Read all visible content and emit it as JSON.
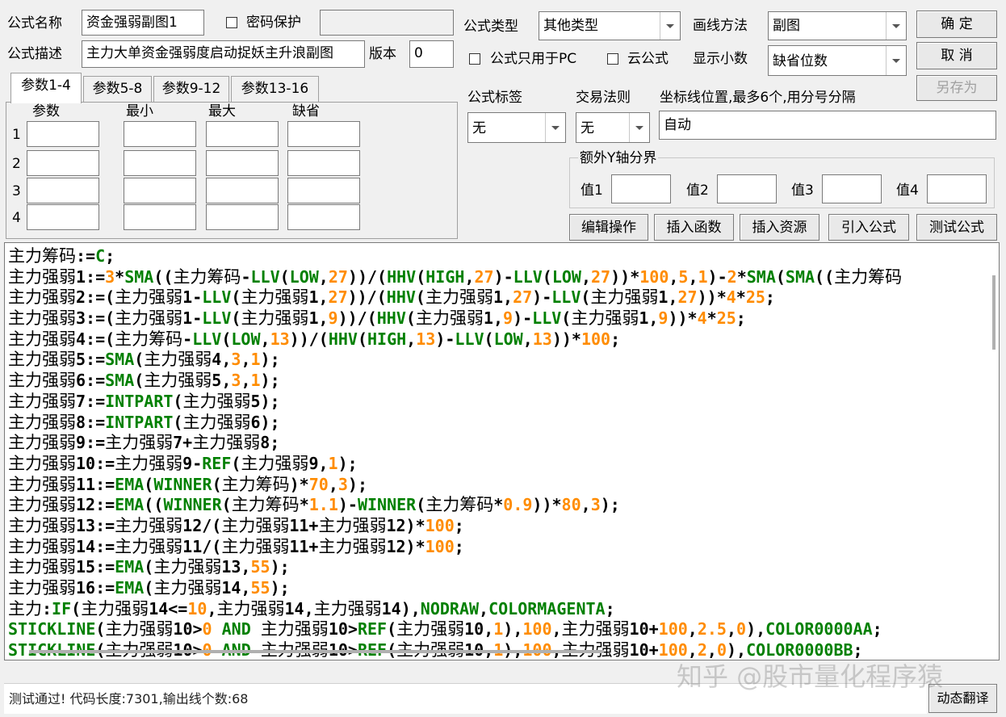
{
  "form": {
    "name_label": "公式名称",
    "name_value": "资金强弱副图1",
    "password_label": "密码保护",
    "desc_label": "公式描述",
    "desc_value": "主力大单资金强弱度启动捉妖主升浪副图",
    "version_label": "版本",
    "version_value": "0",
    "type_label": "公式类型",
    "type_value": "其他类型",
    "draw_label": "画线方法",
    "draw_value": "副图",
    "pc_only_label": "公式只用于PC",
    "cloud_label": "云公式",
    "decimals_label": "显示小数",
    "decimals_value": "缺省位数",
    "tag_label": "公式标签",
    "tag_value": "无",
    "rule_label": "交易法则",
    "rule_value": "无",
    "axis_label": "坐标线位置,最多6个,用分号分隔",
    "axis_value": "自动",
    "y_group_label": "额外Y轴分界",
    "y1_label": "值1",
    "y2_label": "值2",
    "y3_label": "值3",
    "y4_label": "值4"
  },
  "buttons": {
    "ok": "确  定",
    "cancel": "取  消",
    "save_as": "另存为",
    "edit": "编辑操作",
    "insert_func": "插入函数",
    "insert_res": "插入资源",
    "import": "引入公式",
    "test": "测试公式",
    "translate": "动态翻译"
  },
  "tabs": [
    "参数1-4",
    "参数5-8",
    "参数9-12",
    "参数13-16"
  ],
  "params": {
    "headers": [
      "参数",
      "最小",
      "最大",
      "缺省"
    ],
    "rows": [
      "1",
      "2",
      "3",
      "4"
    ]
  },
  "code_lines": [
    [
      [
        "cn",
        "主力筹码"
      ],
      [
        "op",
        ":="
      ],
      [
        "kw",
        "C"
      ],
      [
        "op",
        ";"
      ]
    ],
    [
      [
        "cn",
        "主力强弱"
      ],
      [
        "op",
        "1:="
      ],
      [
        "num",
        "3"
      ],
      [
        "op",
        "*"
      ],
      [
        "kw",
        "SMA"
      ],
      [
        "op",
        "(("
      ],
      [
        "cn",
        "主力筹码"
      ],
      [
        "op",
        "-"
      ],
      [
        "kw",
        "LLV"
      ],
      [
        "op",
        "("
      ],
      [
        "kw",
        "LOW"
      ],
      [
        "op",
        ","
      ],
      [
        "num",
        "27"
      ],
      [
        "op",
        "))/("
      ],
      [
        "kw",
        "HHV"
      ],
      [
        "op",
        "("
      ],
      [
        "kw",
        "HIGH"
      ],
      [
        "op",
        ","
      ],
      [
        "num",
        "27"
      ],
      [
        "op",
        ")-"
      ],
      [
        "kw",
        "LLV"
      ],
      [
        "op",
        "("
      ],
      [
        "kw",
        "LOW"
      ],
      [
        "op",
        ","
      ],
      [
        "num",
        "27"
      ],
      [
        "op",
        "))*"
      ],
      [
        "num",
        "100"
      ],
      [
        "op",
        ","
      ],
      [
        "num",
        "5"
      ],
      [
        "op",
        ","
      ],
      [
        "num",
        "1"
      ],
      [
        "op",
        ")-"
      ],
      [
        "num",
        "2"
      ],
      [
        "op",
        "*"
      ],
      [
        "kw",
        "SMA"
      ],
      [
        "op",
        "("
      ],
      [
        "kw",
        "SMA"
      ],
      [
        "op",
        "(("
      ],
      [
        "cn",
        "主力筹码"
      ]
    ],
    [
      [
        "cn",
        "主力强弱"
      ],
      [
        "op",
        "2:=("
      ],
      [
        "cn",
        "主力强弱"
      ],
      [
        "op",
        "1-"
      ],
      [
        "kw",
        "LLV"
      ],
      [
        "op",
        "("
      ],
      [
        "cn",
        "主力强弱"
      ],
      [
        "op",
        "1,"
      ],
      [
        "num",
        "27"
      ],
      [
        "op",
        "))/("
      ],
      [
        "kw",
        "HHV"
      ],
      [
        "op",
        "("
      ],
      [
        "cn",
        "主力强弱"
      ],
      [
        "op",
        "1,"
      ],
      [
        "num",
        "27"
      ],
      [
        "op",
        ")-"
      ],
      [
        "kw",
        "LLV"
      ],
      [
        "op",
        "("
      ],
      [
        "cn",
        "主力强弱"
      ],
      [
        "op",
        "1,"
      ],
      [
        "num",
        "27"
      ],
      [
        "op",
        "))*"
      ],
      [
        "num",
        "4"
      ],
      [
        "op",
        "*"
      ],
      [
        "num",
        "25"
      ],
      [
        "op",
        ";"
      ]
    ],
    [
      [
        "cn",
        "主力强弱"
      ],
      [
        "op",
        "3:=("
      ],
      [
        "cn",
        "主力强弱"
      ],
      [
        "op",
        "1-"
      ],
      [
        "kw",
        "LLV"
      ],
      [
        "op",
        "("
      ],
      [
        "cn",
        "主力强弱"
      ],
      [
        "op",
        "1,"
      ],
      [
        "num",
        "9"
      ],
      [
        "op",
        "))/("
      ],
      [
        "kw",
        "HHV"
      ],
      [
        "op",
        "("
      ],
      [
        "cn",
        "主力强弱"
      ],
      [
        "op",
        "1,"
      ],
      [
        "num",
        "9"
      ],
      [
        "op",
        ")-"
      ],
      [
        "kw",
        "LLV"
      ],
      [
        "op",
        "("
      ],
      [
        "cn",
        "主力强弱"
      ],
      [
        "op",
        "1,"
      ],
      [
        "num",
        "9"
      ],
      [
        "op",
        "))*"
      ],
      [
        "num",
        "4"
      ],
      [
        "op",
        "*"
      ],
      [
        "num",
        "25"
      ],
      [
        "op",
        ";"
      ]
    ],
    [
      [
        "cn",
        "主力强弱"
      ],
      [
        "op",
        "4:=("
      ],
      [
        "cn",
        "主力筹码"
      ],
      [
        "op",
        "-"
      ],
      [
        "kw",
        "LLV"
      ],
      [
        "op",
        "("
      ],
      [
        "kw",
        "LOW"
      ],
      [
        "op",
        ","
      ],
      [
        "num",
        "13"
      ],
      [
        "op",
        "))/("
      ],
      [
        "kw",
        "HHV"
      ],
      [
        "op",
        "("
      ],
      [
        "kw",
        "HIGH"
      ],
      [
        "op",
        ","
      ],
      [
        "num",
        "13"
      ],
      [
        "op",
        ")-"
      ],
      [
        "kw",
        "LLV"
      ],
      [
        "op",
        "("
      ],
      [
        "kw",
        "LOW"
      ],
      [
        "op",
        ","
      ],
      [
        "num",
        "13"
      ],
      [
        "op",
        "))*"
      ],
      [
        "num",
        "100"
      ],
      [
        "op",
        ";"
      ]
    ],
    [
      [
        "cn",
        "主力强弱"
      ],
      [
        "op",
        "5:="
      ],
      [
        "kw",
        "SMA"
      ],
      [
        "op",
        "("
      ],
      [
        "cn",
        "主力强弱"
      ],
      [
        "op",
        "4,"
      ],
      [
        "num",
        "3"
      ],
      [
        "op",
        ","
      ],
      [
        "num",
        "1"
      ],
      [
        "op",
        ");"
      ]
    ],
    [
      [
        "cn",
        "主力强弱"
      ],
      [
        "op",
        "6:="
      ],
      [
        "kw",
        "SMA"
      ],
      [
        "op",
        "("
      ],
      [
        "cn",
        "主力强弱"
      ],
      [
        "op",
        "5,"
      ],
      [
        "num",
        "3"
      ],
      [
        "op",
        ","
      ],
      [
        "num",
        "1"
      ],
      [
        "op",
        ");"
      ]
    ],
    [
      [
        "cn",
        "主力强弱"
      ],
      [
        "op",
        "7:="
      ],
      [
        "kw",
        "INTPART"
      ],
      [
        "op",
        "("
      ],
      [
        "cn",
        "主力强弱"
      ],
      [
        "op",
        "5);"
      ]
    ],
    [
      [
        "cn",
        "主力强弱"
      ],
      [
        "op",
        "8:="
      ],
      [
        "kw",
        "INTPART"
      ],
      [
        "op",
        "("
      ],
      [
        "cn",
        "主力强弱"
      ],
      [
        "op",
        "6);"
      ]
    ],
    [
      [
        "cn",
        "主力强弱"
      ],
      [
        "op",
        "9:="
      ],
      [
        "cn",
        "主力强弱"
      ],
      [
        "op",
        "7+"
      ],
      [
        "cn",
        "主力强弱"
      ],
      [
        "op",
        "8;"
      ]
    ],
    [
      [
        "cn",
        "主力强弱"
      ],
      [
        "op",
        "10:="
      ],
      [
        "cn",
        "主力强弱"
      ],
      [
        "op",
        "9-"
      ],
      [
        "kw",
        "REF"
      ],
      [
        "op",
        "("
      ],
      [
        "cn",
        "主力强弱"
      ],
      [
        "op",
        "9,"
      ],
      [
        "num",
        "1"
      ],
      [
        "op",
        ");"
      ]
    ],
    [
      [
        "cn",
        "主力强弱"
      ],
      [
        "op",
        "11:="
      ],
      [
        "kw",
        "EMA"
      ],
      [
        "op",
        "("
      ],
      [
        "kw",
        "WINNER"
      ],
      [
        "op",
        "("
      ],
      [
        "cn",
        "主力筹码"
      ],
      [
        "op",
        ")*"
      ],
      [
        "num",
        "70"
      ],
      [
        "op",
        ","
      ],
      [
        "num",
        "3"
      ],
      [
        "op",
        ");"
      ]
    ],
    [
      [
        "cn",
        "主力强弱"
      ],
      [
        "op",
        "12:="
      ],
      [
        "kw",
        "EMA"
      ],
      [
        "op",
        "(("
      ],
      [
        "kw",
        "WINNER"
      ],
      [
        "op",
        "("
      ],
      [
        "cn",
        "主力筹码"
      ],
      [
        "op",
        "*"
      ],
      [
        "num",
        "1.1"
      ],
      [
        "op",
        ")-"
      ],
      [
        "kw",
        "WINNER"
      ],
      [
        "op",
        "("
      ],
      [
        "cn",
        "主力筹码"
      ],
      [
        "op",
        "*"
      ],
      [
        "num",
        "0.9"
      ],
      [
        "op",
        "))*"
      ],
      [
        "num",
        "80"
      ],
      [
        "op",
        ","
      ],
      [
        "num",
        "3"
      ],
      [
        "op",
        ");"
      ]
    ],
    [
      [
        "cn",
        "主力强弱"
      ],
      [
        "op",
        "13:="
      ],
      [
        "cn",
        "主力强弱"
      ],
      [
        "op",
        "12/("
      ],
      [
        "cn",
        "主力强弱"
      ],
      [
        "op",
        "11+"
      ],
      [
        "cn",
        "主力强弱"
      ],
      [
        "op",
        "12)*"
      ],
      [
        "num",
        "100"
      ],
      [
        "op",
        ";"
      ]
    ],
    [
      [
        "cn",
        "主力强弱"
      ],
      [
        "op",
        "14:="
      ],
      [
        "cn",
        "主力强弱"
      ],
      [
        "op",
        "11/("
      ],
      [
        "cn",
        "主力强弱"
      ],
      [
        "op",
        "11+"
      ],
      [
        "cn",
        "主力强弱"
      ],
      [
        "op",
        "12)*"
      ],
      [
        "num",
        "100"
      ],
      [
        "op",
        ";"
      ]
    ],
    [
      [
        "cn",
        "主力强弱"
      ],
      [
        "op",
        "15:="
      ],
      [
        "kw",
        "EMA"
      ],
      [
        "op",
        "("
      ],
      [
        "cn",
        "主力强弱"
      ],
      [
        "op",
        "13,"
      ],
      [
        "num",
        "55"
      ],
      [
        "op",
        ");"
      ]
    ],
    [
      [
        "cn",
        "主力强弱"
      ],
      [
        "op",
        "16:="
      ],
      [
        "kw",
        "EMA"
      ],
      [
        "op",
        "("
      ],
      [
        "cn",
        "主力强弱"
      ],
      [
        "op",
        "14,"
      ],
      [
        "num",
        "55"
      ],
      [
        "op",
        ");"
      ]
    ],
    [
      [
        "cn",
        "主力"
      ],
      [
        "op",
        ":"
      ],
      [
        "kw",
        "IF"
      ],
      [
        "op",
        "("
      ],
      [
        "cn",
        "主力强弱"
      ],
      [
        "op",
        "14<="
      ],
      [
        "num",
        "10"
      ],
      [
        "op",
        ","
      ],
      [
        "cn",
        "主力强弱"
      ],
      [
        "op",
        "14,"
      ],
      [
        "cn",
        "主力强弱"
      ],
      [
        "op",
        "14),"
      ],
      [
        "kw",
        "NODRAW"
      ],
      [
        "op",
        ","
      ],
      [
        "kw",
        "COLORMAGENTA"
      ],
      [
        "op",
        ";"
      ]
    ],
    [
      [
        "kw",
        "STICKLINE"
      ],
      [
        "op",
        "("
      ],
      [
        "cn",
        "主力强弱"
      ],
      [
        "op",
        "10>"
      ],
      [
        "num",
        "0"
      ],
      [
        "op",
        " "
      ],
      [
        "kw",
        "AND"
      ],
      [
        "op",
        " "
      ],
      [
        "cn",
        "主力强弱"
      ],
      [
        "op",
        "10>"
      ],
      [
        "kw",
        "REF"
      ],
      [
        "op",
        "("
      ],
      [
        "cn",
        "主力强弱"
      ],
      [
        "op",
        "10,"
      ],
      [
        "num",
        "1"
      ],
      [
        "op",
        "),"
      ],
      [
        "num",
        "100"
      ],
      [
        "op",
        ","
      ],
      [
        "cn",
        "主力强弱"
      ],
      [
        "op",
        "10+"
      ],
      [
        "num",
        "100"
      ],
      [
        "op",
        ","
      ],
      [
        "num",
        "2.5"
      ],
      [
        "op",
        ","
      ],
      [
        "num",
        "0"
      ],
      [
        "op",
        "),"
      ],
      [
        "kw",
        "COLOR0000AA"
      ],
      [
        "op",
        ";"
      ]
    ],
    [
      [
        "kw",
        "STICKLINE"
      ],
      [
        "op",
        "("
      ],
      [
        "cn",
        "主力强弱"
      ],
      [
        "op",
        "10>"
      ],
      [
        "num",
        "0"
      ],
      [
        "op",
        " "
      ],
      [
        "kw",
        "AND"
      ],
      [
        "op",
        " "
      ],
      [
        "cn",
        "主力强弱"
      ],
      [
        "op",
        "10>"
      ],
      [
        "kw",
        "REF"
      ],
      [
        "op",
        "("
      ],
      [
        "cn",
        "主力强弱"
      ],
      [
        "op",
        "10,"
      ],
      [
        "num",
        "1"
      ],
      [
        "op",
        "),"
      ],
      [
        "num",
        "100"
      ],
      [
        "op",
        ","
      ],
      [
        "cn",
        "主力强弱"
      ],
      [
        "op",
        "10+"
      ],
      [
        "num",
        "100"
      ],
      [
        "op",
        ","
      ],
      [
        "num",
        "2"
      ],
      [
        "op",
        ","
      ],
      [
        "num",
        "0"
      ],
      [
        "op",
        "),"
      ],
      [
        "kw",
        "COLOR0000BB"
      ],
      [
        "op",
        ";"
      ]
    ]
  ],
  "status_text": "测试通过! 代码长度:7301,输出线个数:68",
  "watermark": "知乎 @股市量化程序猿"
}
